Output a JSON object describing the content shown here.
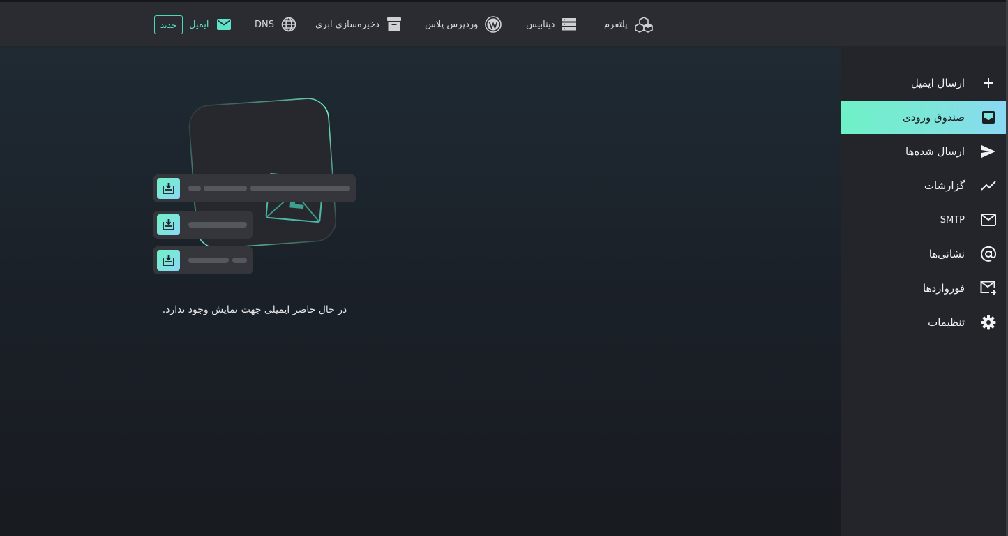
{
  "topnav": {
    "items": [
      {
        "label": "پلتفرم",
        "icon": "cubes-icon"
      },
      {
        "label": "دیتابیس",
        "icon": "database-icon"
      },
      {
        "label": "وردپرس پلاس",
        "icon": "wordpress-icon"
      },
      {
        "label": "ذخیره‌سازی ابری",
        "icon": "archive-icon"
      },
      {
        "label": "DNS",
        "icon": "globe-icon"
      },
      {
        "label": "ایمیل",
        "icon": "mail-icon",
        "active": true
      }
    ],
    "new_badge": "جدید"
  },
  "sidebar": {
    "items": [
      {
        "label": "ارسال ایمیل",
        "icon": "plus-icon"
      },
      {
        "label": "صندوق ورودی",
        "icon": "inbox-icon",
        "active": true
      },
      {
        "label": "ارسال شده‌ها",
        "icon": "send-icon"
      },
      {
        "label": "گزارشات",
        "icon": "chart-line-icon"
      },
      {
        "label": "SMTP",
        "icon": "envelope-icon"
      },
      {
        "label": "نشانی‌ها",
        "icon": "at-sign-icon"
      },
      {
        "label": "فورواردها",
        "icon": "forward-mail-icon"
      },
      {
        "label": "تنظیمات",
        "icon": "gear-icon"
      }
    ]
  },
  "empty_state": {
    "message": "در حال حاضر ایمیلی جهت نمایش وجود ندارد.",
    "illustration": "empty-inbox-illustration",
    "illustration_letter": "E"
  },
  "colors": {
    "accent": "#5fe3c8",
    "sidebar_active_gradient": [
      "#6ff1c6",
      "#8ad8f4"
    ],
    "topbar_bg": "#2a2c31",
    "sidebar_bg": "#23252a"
  }
}
